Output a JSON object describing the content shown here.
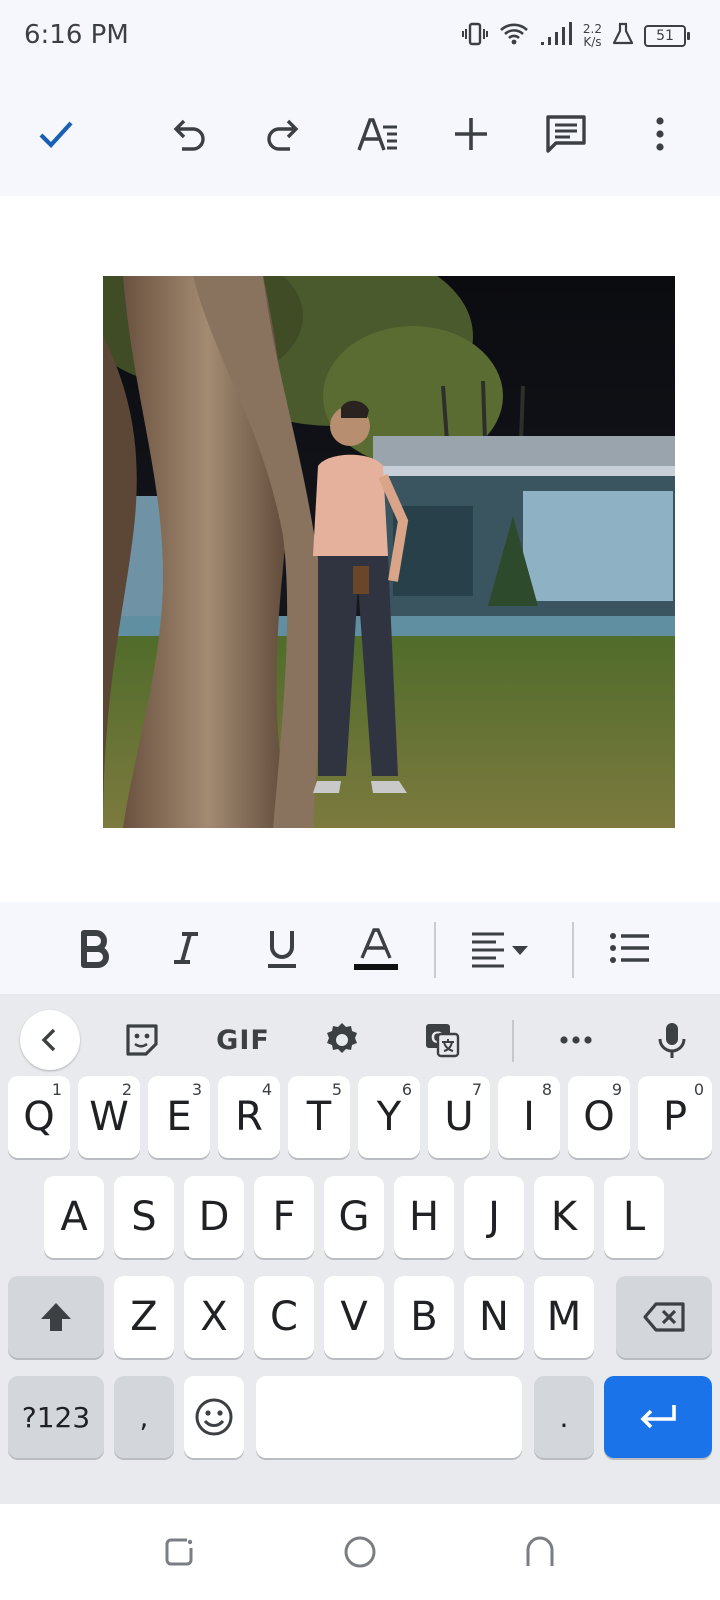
{
  "status_bar": {
    "time": "6:16 PM",
    "net_speed_value": "2.2",
    "net_speed_unit": "K/s",
    "battery": "51",
    "icons": [
      "vibrate-icon",
      "wifi-icon",
      "signal-icon",
      "beaker-icon",
      "battery-icon"
    ]
  },
  "toolbar": {
    "accent_color": "#1a5fb4",
    "buttons": [
      "check-icon",
      "undo-icon",
      "redo-icon",
      "text-format-icon",
      "insert-icon",
      "comment-icon",
      "more-vert-icon"
    ]
  },
  "document": {
    "image": "photo of a person leaning against a tree at night"
  },
  "format_bar": {
    "buttons": [
      "bold-icon",
      "italic-icon",
      "underline-icon",
      "text-color-icon",
      "align-dropdown-icon",
      "bullet-list-icon"
    ]
  },
  "keyboard": {
    "toolbar": [
      "back-chevron-icon",
      "sticker-icon",
      "gif-icon",
      "settings-icon",
      "translate-icon",
      "more-horiz-icon",
      "microphone-icon"
    ],
    "gif_label": "GIF",
    "row1": [
      {
        "k": "Q",
        "h": "1"
      },
      {
        "k": "W",
        "h": "2"
      },
      {
        "k": "E",
        "h": "3"
      },
      {
        "k": "R",
        "h": "4"
      },
      {
        "k": "T",
        "h": "5"
      },
      {
        "k": "Y",
        "h": "6"
      },
      {
        "k": "U",
        "h": "7"
      },
      {
        "k": "I",
        "h": "8"
      },
      {
        "k": "O",
        "h": "9"
      },
      {
        "k": "P",
        "h": "0"
      }
    ],
    "row2": [
      "A",
      "S",
      "D",
      "F",
      "G",
      "H",
      "J",
      "K",
      "L"
    ],
    "row3": [
      "Z",
      "X",
      "C",
      "V",
      "B",
      "N",
      "M"
    ],
    "symbols_label": "?123",
    "comma_label": ",",
    "period_label": ".",
    "enter_color": "#1a73e8"
  },
  "nav_bar": {
    "buttons": [
      "recents-icon",
      "home-icon",
      "back-icon"
    ]
  }
}
